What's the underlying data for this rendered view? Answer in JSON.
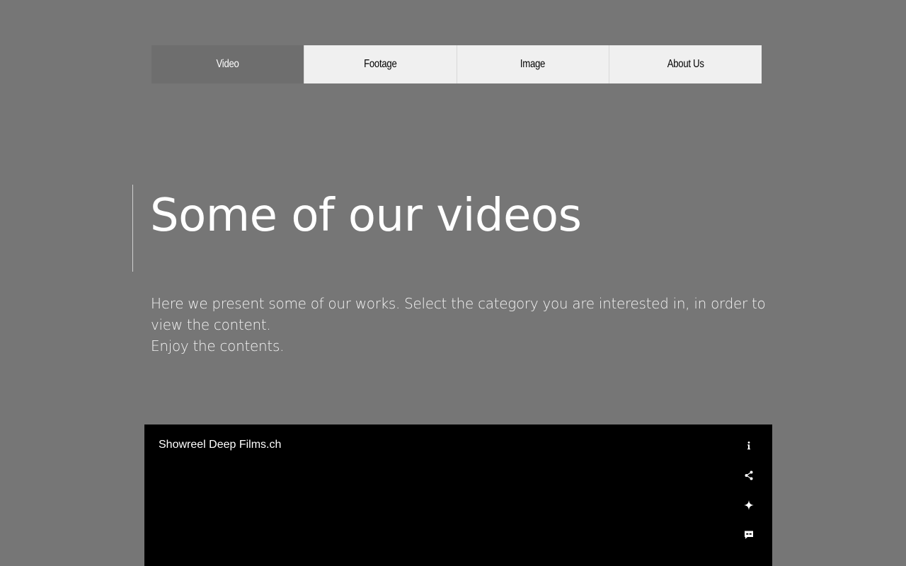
{
  "nav": {
    "tabs": [
      {
        "label": "Video",
        "active": true
      },
      {
        "label": "Footage",
        "active": false
      },
      {
        "label": "Image",
        "active": false
      },
      {
        "label": "About Us",
        "active": false
      }
    ]
  },
  "hero": {
    "title": "Some of our videos",
    "description_line1": "Here we present some of our works. Select the category you are interested in, in order to view the content.",
    "description_line2": "Enjoy the contents."
  },
  "video_player": {
    "title": "Showreel Deep Films.ch",
    "controls": [
      {
        "icon": "info-icon"
      },
      {
        "icon": "share-icon"
      },
      {
        "icon": "sparkle-icon"
      },
      {
        "icon": "captions-icon"
      }
    ]
  },
  "colors": {
    "page_background": "#767676",
    "tab_background": "#f0f0f0",
    "tab_active_background": "#6e6e6e",
    "player_background": "#000000",
    "text_light": "#ffffff"
  }
}
